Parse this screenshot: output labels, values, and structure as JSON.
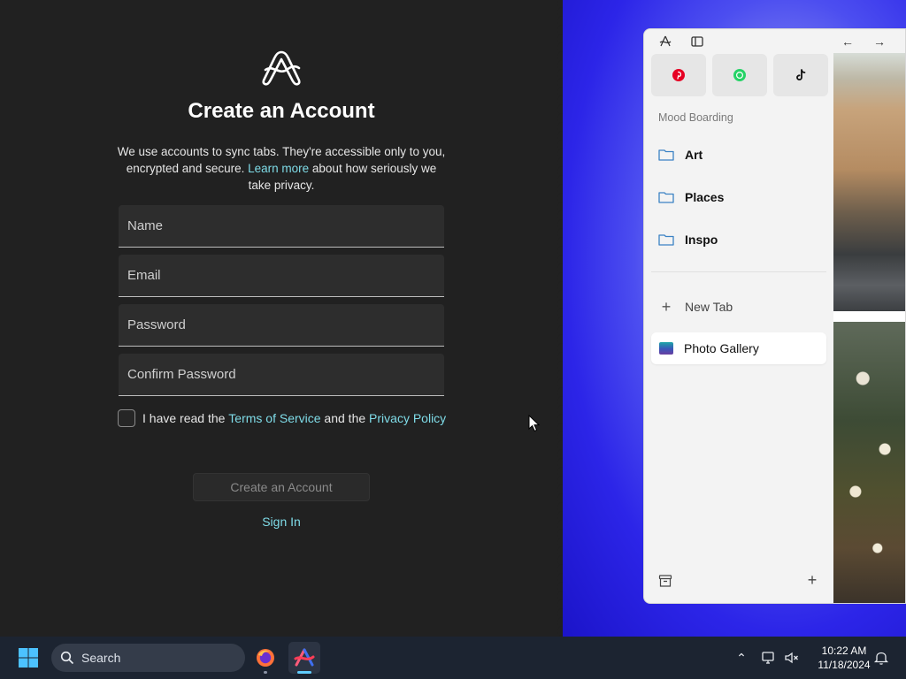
{
  "signup": {
    "title": "Create an Account",
    "subtitle_before": "We use accounts to sync tabs. They're accessible only to you, encrypted and secure. ",
    "subtitle_link": "Learn more",
    "subtitle_after": " about how seriously we take privacy.",
    "fields": {
      "name_placeholder": "Name",
      "email_placeholder": "Email",
      "password_placeholder": "Password",
      "confirm_placeholder": "Confirm Password"
    },
    "terms": {
      "prefix": "I have read the ",
      "tos_link": "Terms of Service",
      "middle": " and the ",
      "privacy_link": "Privacy Policy",
      "checked": false
    },
    "create_button": "Create an Account",
    "signin_link": "Sign In",
    "accent_color": "#7fdce8"
  },
  "browser": {
    "favorites": [
      {
        "name": "Pinterest",
        "icon": "pinterest-icon",
        "color": "#e60023"
      },
      {
        "name": "WhatsApp",
        "icon": "whatsapp-icon",
        "color": "#25d366"
      },
      {
        "name": "TikTok",
        "icon": "tiktok-icon",
        "color": "#111111"
      }
    ],
    "section_label": "Mood Boarding",
    "folders": [
      "Art",
      "Places",
      "Inspo"
    ],
    "new_tab_label": "New Tab",
    "active_tab_label": "Photo Gallery"
  },
  "taskbar": {
    "search_label": "Search",
    "time": "10:22 AM",
    "date": "11/18/2024"
  }
}
